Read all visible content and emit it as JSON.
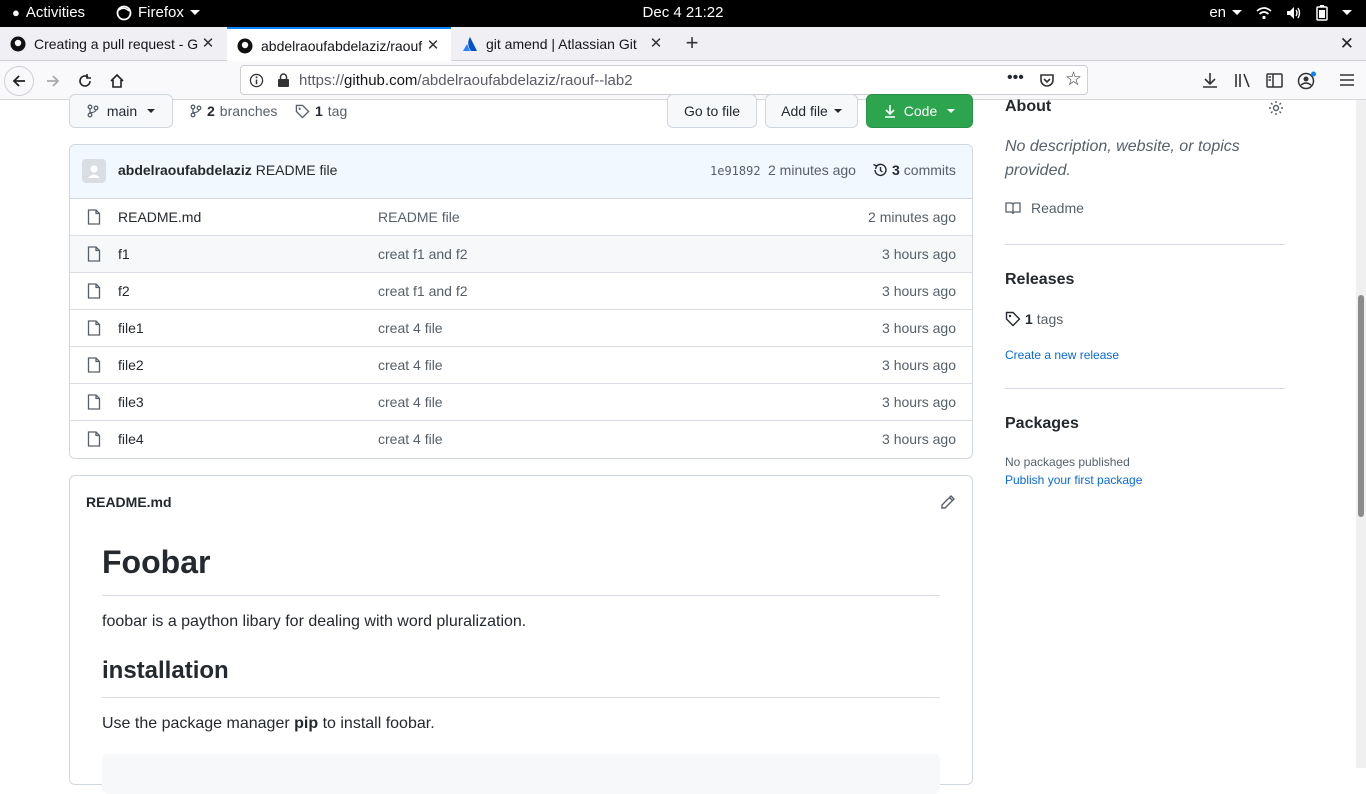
{
  "system": {
    "activities": "Activities",
    "app_name": "Firefox",
    "clock": "Dec 4  21:22",
    "lang": "en"
  },
  "tabs": [
    {
      "title": "Creating a pull request - G"
    },
    {
      "title": "abdelraoufabdelaziz/raouf"
    },
    {
      "title": "git amend | Atlassian Git"
    }
  ],
  "urlbar": {
    "prefix": "https://",
    "domain": "github.com",
    "path": "/abdelraoufabdelaziz/raouf--lab2"
  },
  "repo": {
    "branch": "main",
    "branches_count": "2",
    "branches_label": "branches",
    "tags_count": "1",
    "tags_label": "tag",
    "go_to_file": "Go to file",
    "add_file": "Add file",
    "code": "Code"
  },
  "commit": {
    "author": "abdelraoufabdelaziz",
    "message": "README file",
    "sha": "1e91892",
    "age": "2 minutes ago",
    "commits_count": "3",
    "commits_label": "commits"
  },
  "files": [
    {
      "name": "README.md",
      "message": "README file",
      "age": "2 minutes ago"
    },
    {
      "name": "f1",
      "message": "creat f1 and f2",
      "age": "3 hours ago"
    },
    {
      "name": "f2",
      "message": "creat f1 and f2",
      "age": "3 hours ago"
    },
    {
      "name": "file1",
      "message": "creat 4 file",
      "age": "3 hours ago"
    },
    {
      "name": "file2",
      "message": "creat 4 file",
      "age": "3 hours ago"
    },
    {
      "name": "file3",
      "message": "creat 4 file",
      "age": "3 hours ago"
    },
    {
      "name": "file4",
      "message": "creat 4 file",
      "age": "3 hours ago"
    }
  ],
  "readme": {
    "filename": "README.md",
    "h1": "Foobar",
    "intro": "foobar is a paython libary for dealing with word pluralization.",
    "h2": "installation",
    "install_pre": "Use the package manager ",
    "install_bold": "pip",
    "install_post": " to install foobar."
  },
  "sidebar": {
    "about_title": "About",
    "about_desc": "No description, website, or topics provided.",
    "readme_label": "Readme",
    "releases_title": "Releases",
    "tags_count": "1",
    "tags_label": "tags",
    "create_release": "Create a new release",
    "packages_title": "Packages",
    "packages_none": "No packages published",
    "publish_package": "Publish your first package"
  }
}
